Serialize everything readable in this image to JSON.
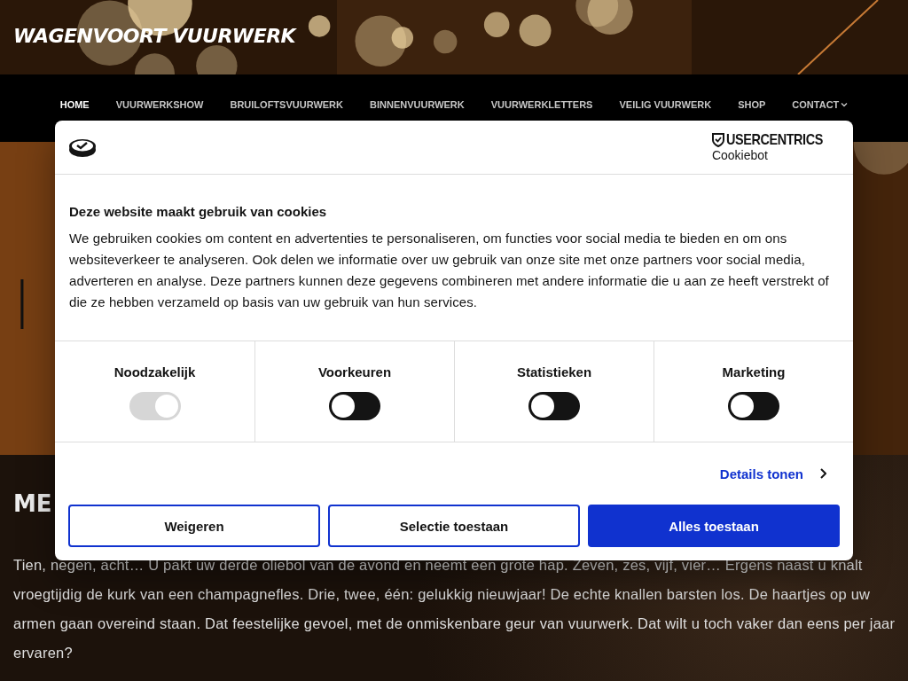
{
  "site": {
    "title": "WAGENVOORT VUURWERK"
  },
  "nav": [
    {
      "label": "HOME",
      "selected": true
    },
    {
      "label": "VUURWERKSHOW",
      "selected": false
    },
    {
      "label": "BRUILOFTSVUURWERK",
      "selected": false
    },
    {
      "label": "BINNENVUURWERK",
      "selected": false
    },
    {
      "label": "VUURWERKLETTERS",
      "selected": false
    },
    {
      "label": "VEILIG VUURWERK",
      "selected": false
    },
    {
      "label": "SHOP",
      "selected": false
    },
    {
      "label": "CONTACT",
      "selected": false,
      "dropdown": true
    }
  ],
  "hero": {
    "heading": "I"
  },
  "section": {
    "heading": "ME",
    "paragraph": "Tien, negen, acht… U pakt uw derde oliebol van de avond en neemt een grote hap. Zeven, zes, vijf, vier… Ergens naast u knalt vroegtijdig de kurk van een champagnefles. Drie, twee, één: gelukkig nieuwjaar! De echte knallen barsten los. De haartjes op uw armen gaan overeind staan. Dat feestelijke gevoel, met de onmiskenbare geur van vuurwerk. Dat wilt u toch vaker dan eens per jaar ervaren?"
  },
  "cookie_dialog": {
    "brand": "USERCENTRICS",
    "brand_sub": "Cookiebot",
    "title": "Deze website maakt gebruik van cookies",
    "text": "We gebruiken cookies om content en advertenties te personaliseren, om functies voor social media te bieden en om ons websiteverkeer te analyseren. Ook delen we informatie over uw gebruik van onze site met onze partners voor social media, adverteren en analyse. Deze partners kunnen deze gegevens combineren met andere informatie die u aan ze heeft verstrekt of die ze hebben verzameld op basis van uw gebruik van hun services.",
    "categories": [
      {
        "label": "Noodzakelijk",
        "checked": true,
        "disabled": true
      },
      {
        "label": "Voorkeuren",
        "checked": false,
        "disabled": false
      },
      {
        "label": "Statistieken",
        "checked": false,
        "disabled": false
      },
      {
        "label": "Marketing",
        "checked": false,
        "disabled": false
      }
    ],
    "details_link": "Details tonen",
    "buttons": [
      {
        "label": "Weigeren",
        "kind": "outline"
      },
      {
        "label": "Selectie toestaan",
        "kind": "outline"
      },
      {
        "label": "Alles toestaan",
        "kind": "primary"
      }
    ]
  }
}
